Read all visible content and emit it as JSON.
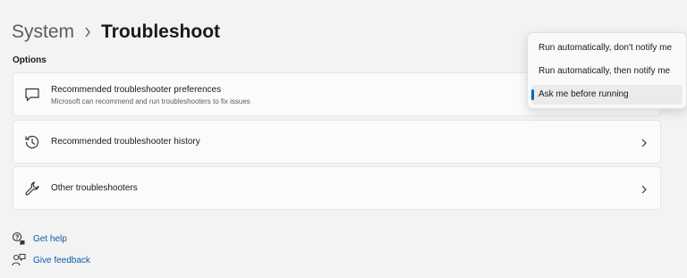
{
  "breadcrumb": {
    "parent": "System",
    "separator_icon": "chevron-right-icon",
    "current": "Troubleshoot"
  },
  "section": {
    "label": "Options"
  },
  "cards": [
    {
      "icon": "chat-bubble-icon",
      "title": "Recommended troubleshooter preferences",
      "subtitle": "Microsoft can recommend and run troubleshooters to fix issues"
    },
    {
      "icon": "history-icon",
      "title": "Recommended troubleshooter history",
      "chevron": "chevron-right-icon"
    },
    {
      "icon": "wrench-icon",
      "title": "Other troubleshooters",
      "chevron": "chevron-right-icon"
    }
  ],
  "links": {
    "get_help": "Get help",
    "give_feedback": "Give feedback"
  },
  "dropdown": {
    "options": [
      "Run automatically, don't notify me",
      "Run automatically, then notify me",
      "Ask me before running"
    ],
    "selected": "Ask me before running"
  },
  "colors": {
    "background": "#f3f3f3",
    "card": "#fbfbfb",
    "accent": "#0067c0",
    "link": "#0b5cad"
  }
}
